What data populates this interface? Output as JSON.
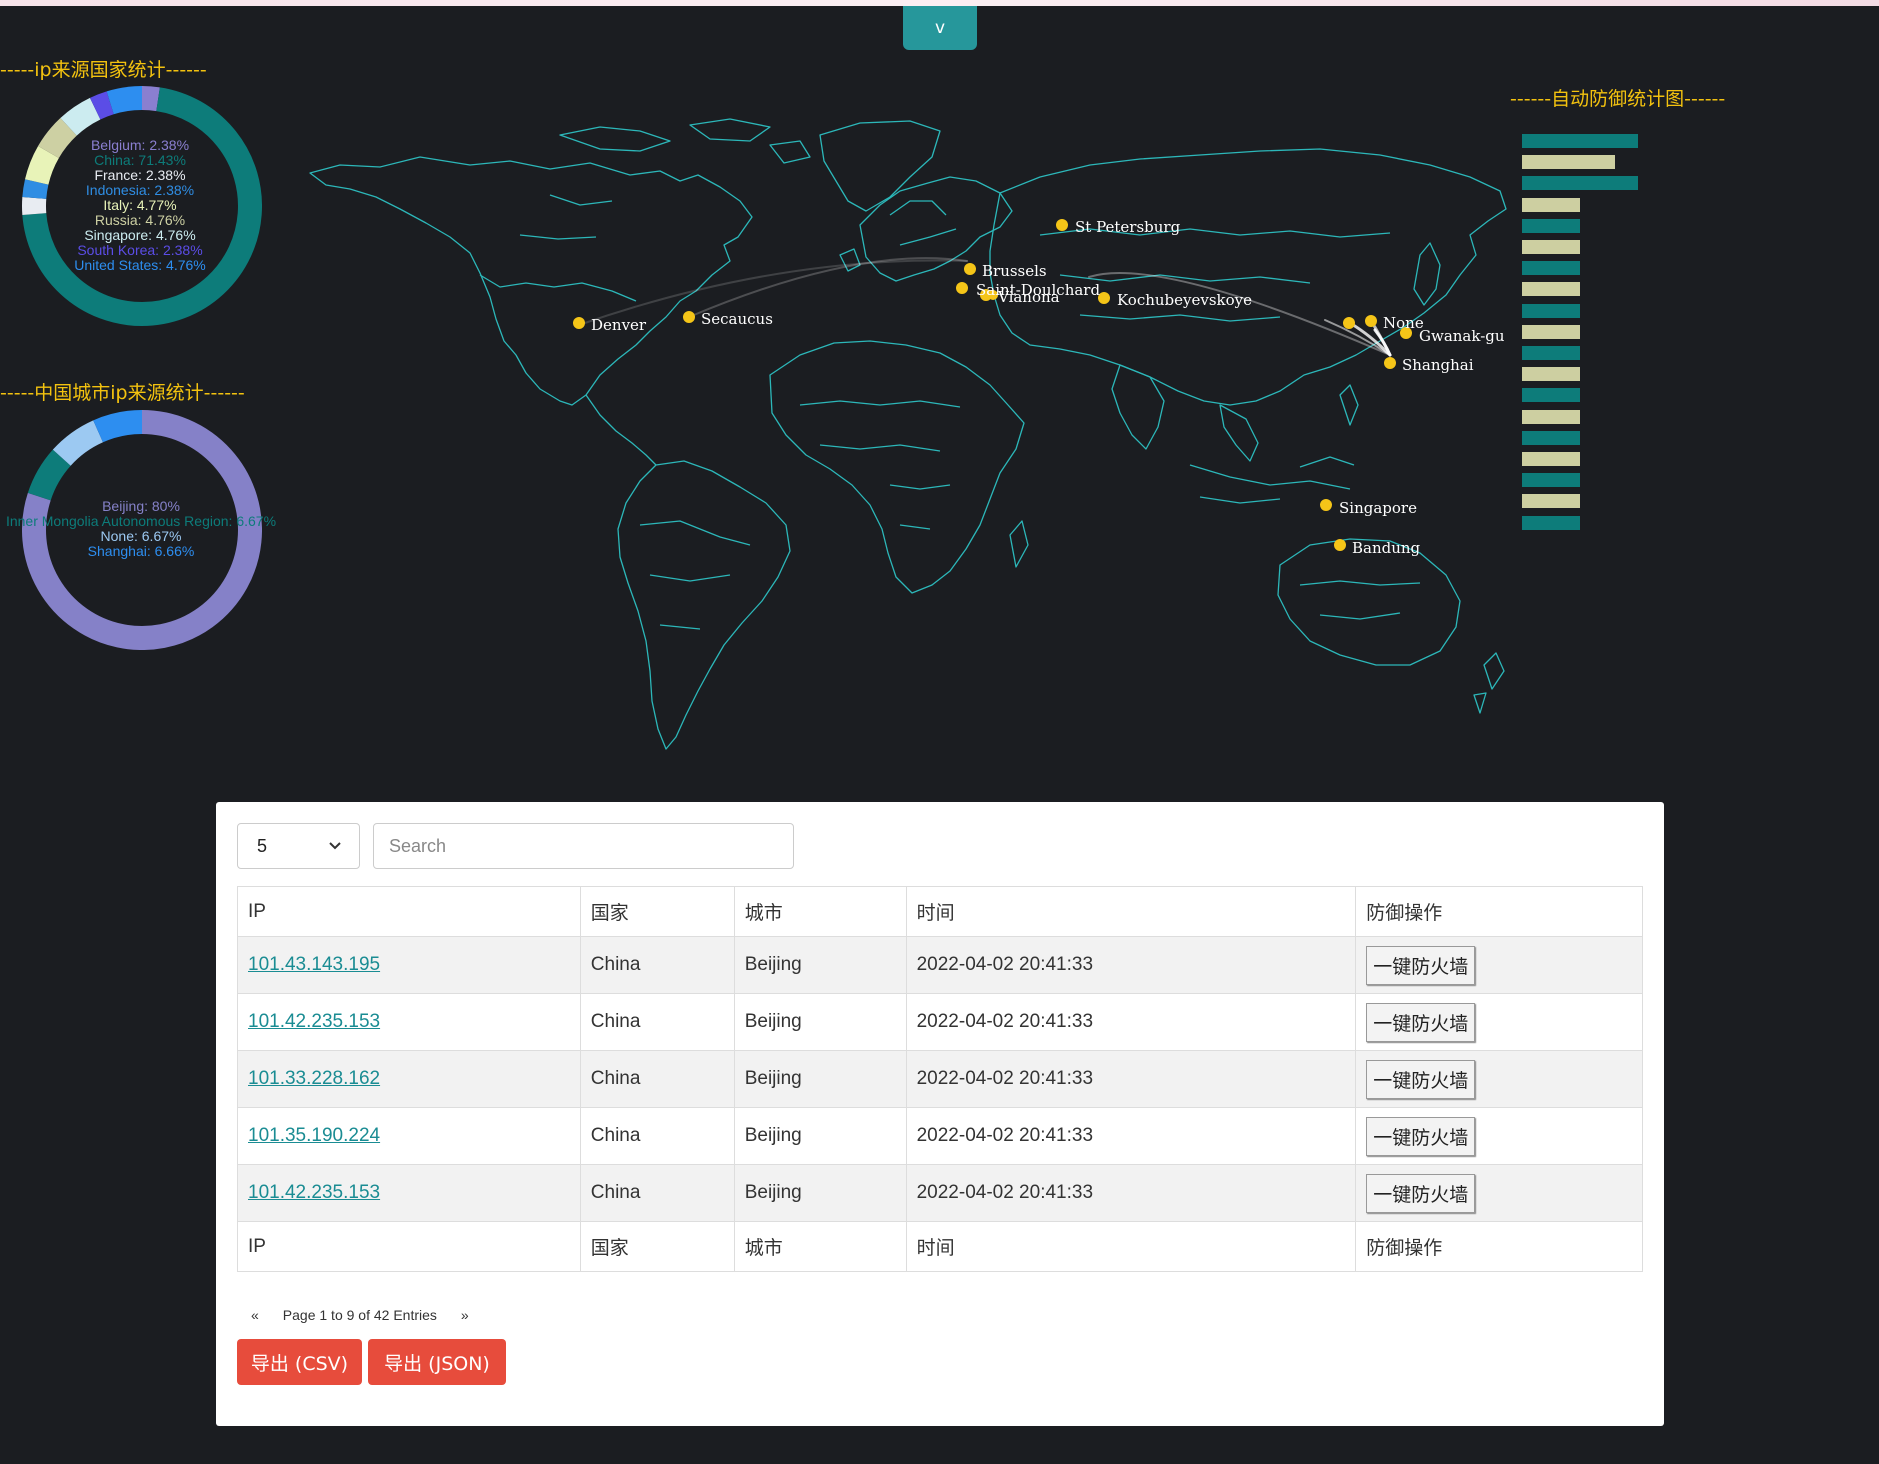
{
  "toggle_label": "v",
  "titles": {
    "country": "-----ip来源国家统计------",
    "city": "-----中国城市ip来源统计------",
    "defense": "------自动防御统计图------"
  },
  "country_chart": {
    "slices": [
      {
        "label": "Belgium: 2.38%",
        "color": "#8a7fd0",
        "value": 2.38
      },
      {
        "label": "China: 71.43%",
        "color": "#0d7c7a",
        "value": 71.43
      },
      {
        "label": "France: 2.38%",
        "color": "#e8ecf2",
        "value": 2.38
      },
      {
        "label": "Indonesia: 2.38%",
        "color": "#2f8de3",
        "value": 2.38
      },
      {
        "label": "Italy: 4.77%",
        "color": "#e8f3b8",
        "value": 4.77
      },
      {
        "label": "Russia: 4.76%",
        "color": "#cdd0a3",
        "value": 4.76
      },
      {
        "label": "Singapore: 4.76%",
        "color": "#ccecf0",
        "value": 4.76
      },
      {
        "label": "South Korea: 2.38%",
        "color": "#5b4de6",
        "value": 2.38
      },
      {
        "label": "United States: 4.76%",
        "color": "#2d8ef0",
        "value": 4.76
      }
    ]
  },
  "city_chart": {
    "slices": [
      {
        "label": "Beijing: 80%",
        "color": "#8581c8",
        "value": 80
      },
      {
        "label": "Inner Mongolia Autonomous Region: 6.67%",
        "color": "#0d7c7a",
        "value": 6.67
      },
      {
        "label": "None: 6.67%",
        "color": "#9cc9f2",
        "value": 6.67
      },
      {
        "label": "Shanghai: 6.66%",
        "color": "#2d8ef0",
        "value": 6.66
      }
    ]
  },
  "map": {
    "cities": [
      "St Petersburg",
      "Brussels",
      "Saint-Doulchard",
      "Vianona",
      "Kochubeyevskoye",
      "Denver",
      "Secaucus",
      "None",
      "Gwanak-gu",
      "Shanghai",
      "Singapore",
      "Bandung"
    ]
  },
  "defense_bars": {
    "colors": {
      "teal": "#0d7c7a",
      "khaki": "#cdcfa1"
    },
    "values": [
      1.0,
      0.8,
      1.0,
      0.5,
      0.5,
      0.5,
      0.5,
      0.5,
      0.5,
      0.5,
      0.5,
      0.5,
      0.5,
      0.5,
      0.5,
      0.5,
      0.5,
      0.5,
      0.5
    ]
  },
  "table": {
    "page_size": "5",
    "search_placeholder": "Search",
    "headers": [
      "IP",
      "国家",
      "城市",
      "时间",
      "防御操作"
    ],
    "rows": [
      {
        "ip": "101.43.143.195",
        "country": "China",
        "city": "Beijing",
        "time": "2022-04-02 20:41:33",
        "action": "一键防火墙"
      },
      {
        "ip": "101.42.235.153",
        "country": "China",
        "city": "Beijing",
        "time": "2022-04-02 20:41:33",
        "action": "一键防火墙"
      },
      {
        "ip": "101.33.228.162",
        "country": "China",
        "city": "Beijing",
        "time": "2022-04-02 20:41:33",
        "action": "一键防火墙"
      },
      {
        "ip": "101.35.190.224",
        "country": "China",
        "city": "Beijing",
        "time": "2022-04-02 20:41:33",
        "action": "一键防火墙"
      },
      {
        "ip": "101.42.235.153",
        "country": "China",
        "city": "Beijing",
        "time": "2022-04-02 20:41:33",
        "action": "一键防火墙"
      }
    ],
    "footers": [
      "IP",
      "国家",
      "城市",
      "时间",
      "防御操作"
    ]
  },
  "pager": {
    "prev": "«",
    "info": "Page 1 to 9 of 42 Entries",
    "next": "»"
  },
  "export": {
    "csv": "导出 (CSV)",
    "json": "导出 (JSON)"
  },
  "accent": "#26979b",
  "title_color": "#f3c20f"
}
